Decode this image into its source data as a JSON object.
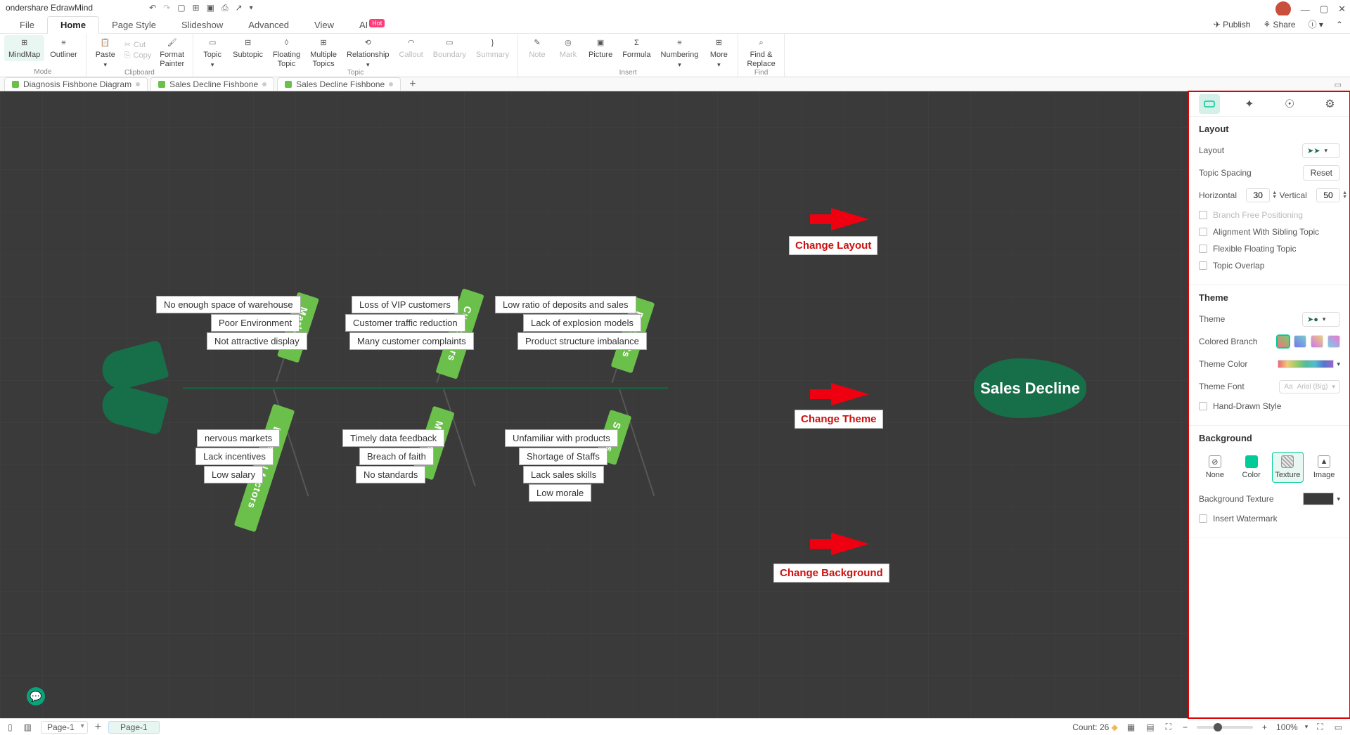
{
  "app": {
    "title": "ondershare EdrawMind"
  },
  "menu": {
    "tabs": [
      "File",
      "Home",
      "Page Style",
      "Slideshow",
      "Advanced",
      "View"
    ],
    "active": 1,
    "ai_label": "AI",
    "ai_badge": "Hot",
    "right": {
      "publish": "Publish",
      "share": "Share"
    }
  },
  "ribbon": {
    "mode": {
      "mindmap": "MindMap",
      "outliner": "Outliner",
      "label": "Mode"
    },
    "clipboard": {
      "paste": "Paste",
      "cut": "Cut",
      "copy": "Copy",
      "fp": "Format\nPainter",
      "label": "Clipboard"
    },
    "topic": {
      "topic": "Topic",
      "subtopic": "Subtopic",
      "floating": "Floating\nTopic",
      "multiple": "Multiple\nTopics",
      "relationship": "Relationship",
      "callout": "Callout",
      "boundary": "Boundary",
      "summary": "Summary",
      "label": "Topic"
    },
    "insert": {
      "note": "Note",
      "mark": "Mark",
      "picture": "Picture",
      "formula": "Formula",
      "numbering": "Numbering",
      "more": "More",
      "label": "Insert"
    },
    "find": {
      "find": "Find &\nReplace",
      "label": "Find"
    }
  },
  "docTabs": [
    {
      "name": "Diagnosis Fishbone Diagram"
    },
    {
      "name": "Sales Decline Fishbone"
    },
    {
      "name": "Sales Decline Fishbone"
    }
  ],
  "fish": {
    "head": "Sales Decline",
    "cats": {
      "markets": "Markets",
      "customers": "Customers",
      "products": "Products",
      "external": "External factors",
      "methods": "Methods",
      "staffs": "Staffs"
    },
    "causes": {
      "markets": [
        "No enough space of warehouse",
        "Poor Environment",
        "Not attractive display"
      ],
      "customers": [
        "Loss of VIP customers",
        "Customer traffic reduction",
        "Many customer complaints"
      ],
      "products": [
        "Low ratio of deposits and sales",
        "Lack of explosion models",
        "Product structure imbalance"
      ],
      "external": [
        "nervous markets",
        "Lack incentives",
        "Low salary"
      ],
      "methods": [
        "Timely data feedback",
        "Breach of faith",
        "No standards"
      ],
      "staffs": [
        "Unfamiliar with products",
        "Shortage of Staffs",
        "Lack sales skills",
        "Low morale"
      ]
    }
  },
  "annotations": {
    "layout": "Change Layout",
    "theme": "Change Theme",
    "bg": "Change Background"
  },
  "panel": {
    "layout": {
      "title": "Layout",
      "layout_lbl": "Layout",
      "spacing_lbl": "Topic Spacing",
      "reset": "Reset",
      "h_lbl": "Horizontal",
      "h": "30",
      "v_lbl": "Vertical",
      "v": "50",
      "free": "Branch Free Positioning",
      "align": "Alignment With Sibling Topic",
      "flex": "Flexible Floating Topic",
      "overlap": "Topic Overlap"
    },
    "theme": {
      "title": "Theme",
      "theme_lbl": "Theme",
      "cb": "Colored Branch",
      "tc": "Theme Color",
      "tf": "Theme Font",
      "tf_ph": "Arial (Big)",
      "hand": "Hand-Drawn Style"
    },
    "bg": {
      "title": "Background",
      "none": "None",
      "color": "Color",
      "texture": "Texture",
      "image": "Image",
      "tex_lbl": "Background Texture",
      "wm": "Insert Watermark"
    }
  },
  "status": {
    "page_sel": "Page-1",
    "page_cur": "Page-1",
    "count_lbl": "Count:",
    "count": "26",
    "zoom": "100%"
  }
}
